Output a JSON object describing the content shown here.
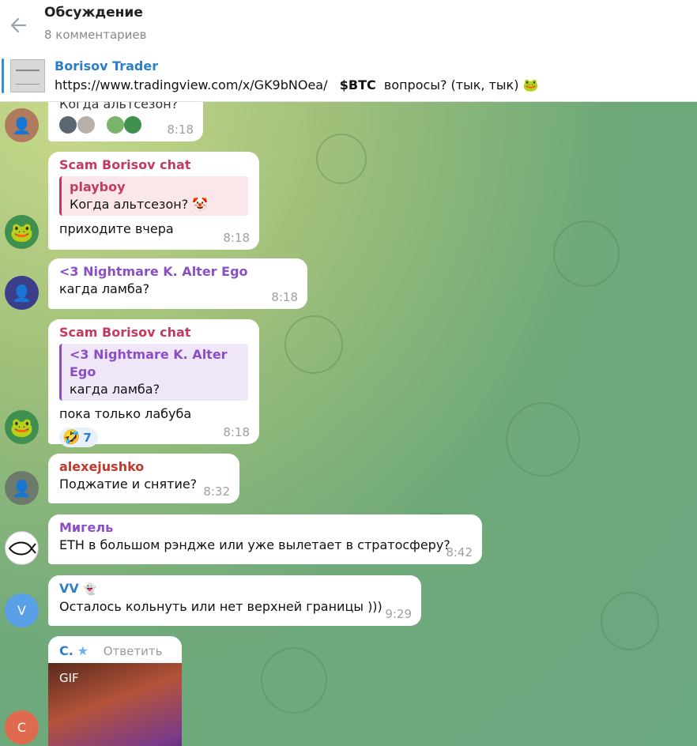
{
  "header": {
    "title": "Обсуждение",
    "subtitle": "8 комментариев"
  },
  "pinned": {
    "name": "Borisov Trader",
    "url": "https://www.tradingview.com/x/GK9bNOea/",
    "ticker": "$BTC",
    "text": "вопросы? (тык, тык)"
  },
  "messages": [
    {
      "partial_text": "Когда альтсезон?",
      "time": "8:18"
    },
    {
      "sender": "Scam Borisov chat",
      "quote_name": "playboy",
      "quote_text": "Когда альтсезон? 🤡",
      "text": "приходите вчера",
      "time": "8:18"
    },
    {
      "sender": "<3 Nightmare K. Alter Ego",
      "text": "кагда ламба?",
      "time": "8:18"
    },
    {
      "sender": "Scam Borisov chat",
      "quote_name": "<3 Nightmare K. Alter Ego",
      "quote_text": "кагда ламба?",
      "text": "пока только лабуба",
      "reaction_emoji": "🤣",
      "reaction_count": "7",
      "time": "8:18"
    },
    {
      "sender": "alexejushko",
      "text": "Поджатие и снятие?",
      "time": "8:32"
    },
    {
      "sender": "Мигель",
      "text": "ETH в большом рэндже или уже вылетает в стратосферу?",
      "time": "8:42"
    },
    {
      "sender": "VV",
      "avatar_letter": "V",
      "text": "Осталось кольнуть или нет верхней границы )))",
      "time": "9:29"
    },
    {
      "sender": "C.",
      "reply_label": "Ответить",
      "gif_label": "GIF",
      "avatar_letter": "C"
    }
  ],
  "colors": {
    "accent": "#2c7fc4",
    "scam": "#c23b5f",
    "nightmare": "#8a4fc4",
    "alex": "#c0392b",
    "migel": "#8a4fc4",
    "vv": "#2c7fc4"
  }
}
